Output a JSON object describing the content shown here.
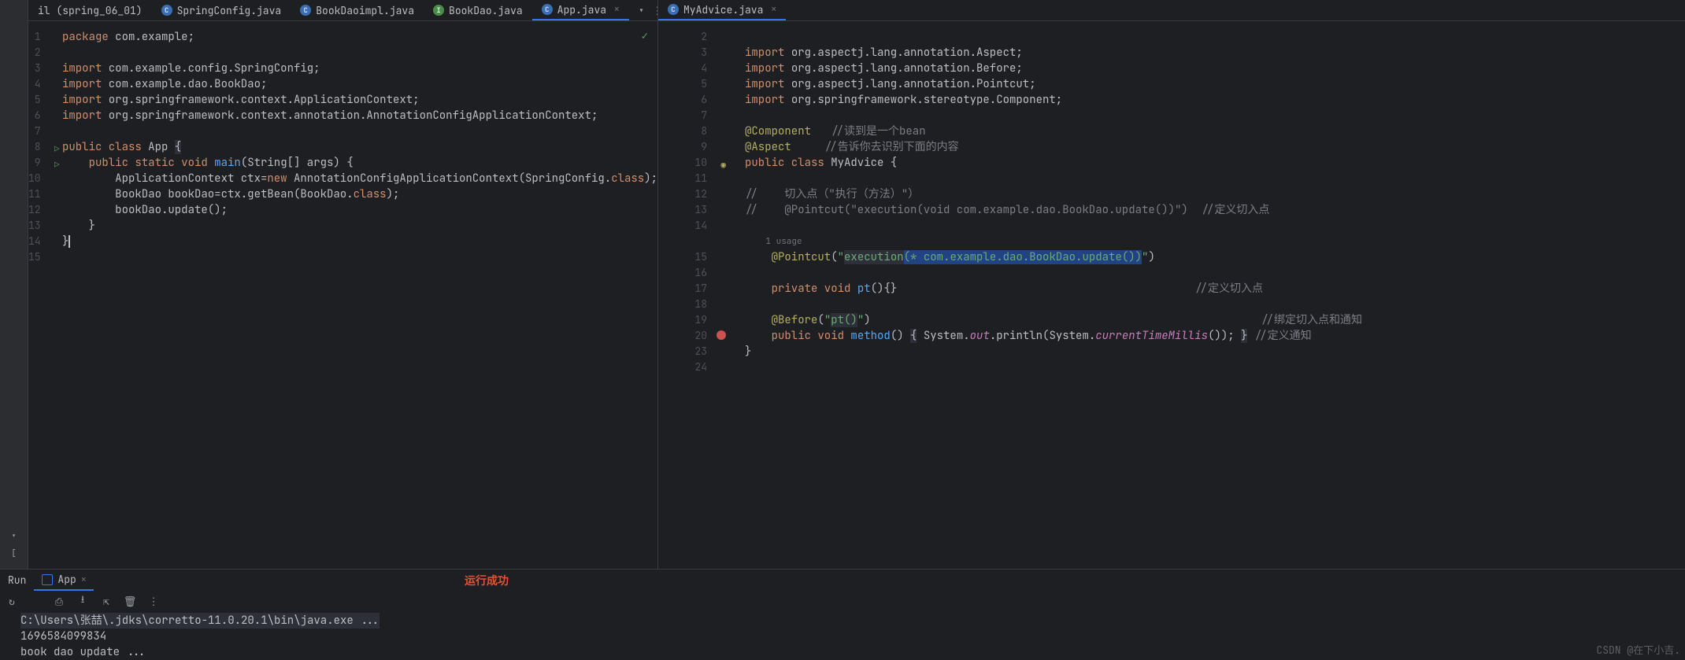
{
  "left": {
    "tabs": [
      {
        "label": "il (spring_06_01)",
        "icon": "",
        "active": false
      },
      {
        "label": "SpringConfig.java",
        "icon": "C",
        "active": false
      },
      {
        "label": "BookDaoimpl.java",
        "icon": "C",
        "active": false
      },
      {
        "label": "BookDao.java",
        "icon": "I",
        "active": false
      },
      {
        "label": "App.java",
        "icon": "C",
        "active": true
      }
    ],
    "status_ok": "✓",
    "code": [
      {
        "n": 1,
        "tokens": [
          {
            "t": "package ",
            "c": "kw"
          },
          {
            "t": "com.example;",
            "c": "cls"
          }
        ]
      },
      {
        "n": 2,
        "tokens": []
      },
      {
        "n": 3,
        "tokens": [
          {
            "t": "import ",
            "c": "kw"
          },
          {
            "t": "com.example.config.SpringConfig;",
            "c": "cls"
          }
        ]
      },
      {
        "n": 4,
        "tokens": [
          {
            "t": "import ",
            "c": "kw"
          },
          {
            "t": "com.example.dao.BookDao;",
            "c": "cls"
          }
        ]
      },
      {
        "n": 5,
        "tokens": [
          {
            "t": "import ",
            "c": "kw"
          },
          {
            "t": "org.springframework.context.ApplicationContext;",
            "c": "cls"
          }
        ]
      },
      {
        "n": 6,
        "tokens": [
          {
            "t": "import ",
            "c": "kw"
          },
          {
            "t": "org.springframework.context.annotation.AnnotationConfigApplicationContext;",
            "c": "cls"
          }
        ]
      },
      {
        "n": 7,
        "tokens": []
      },
      {
        "n": 8,
        "run": true,
        "tokens": [
          {
            "t": "public class ",
            "c": "kw"
          },
          {
            "t": "App ",
            "c": "cls"
          },
          {
            "t": "{",
            "c": "cls",
            "hl": true
          }
        ]
      },
      {
        "n": 9,
        "run": true,
        "tokens": [
          {
            "t": "    ",
            "c": ""
          },
          {
            "t": "public static void ",
            "c": "kw"
          },
          {
            "t": "main",
            "c": "fn"
          },
          {
            "t": "(String[] args) {",
            "c": "cls"
          }
        ]
      },
      {
        "n": 10,
        "tokens": [
          {
            "t": "        ApplicationContext ctx=",
            "c": "cls"
          },
          {
            "t": "new ",
            "c": "kw"
          },
          {
            "t": "AnnotationConfigApplicationContext(SpringConfig.",
            "c": "cls"
          },
          {
            "t": "class",
            "c": "kw"
          },
          {
            "t": ");",
            "c": "cls"
          }
        ]
      },
      {
        "n": 11,
        "tokens": [
          {
            "t": "        BookDao bookDao=ctx.getBean(BookDao.",
            "c": "cls"
          },
          {
            "t": "class",
            "c": "kw"
          },
          {
            "t": ");",
            "c": "cls"
          }
        ]
      },
      {
        "n": 12,
        "tokens": [
          {
            "t": "        bookDao.update();",
            "c": "cls"
          }
        ]
      },
      {
        "n": 13,
        "tokens": [
          {
            "t": "    }",
            "c": "cls"
          }
        ]
      },
      {
        "n": 14,
        "tokens": [
          {
            "t": "}",
            "c": "cls"
          }
        ],
        "caret": true
      },
      {
        "n": 15,
        "tokens": []
      }
    ]
  },
  "right": {
    "tabs": [
      {
        "label": "MyAdvice.java",
        "icon": "C",
        "active": true
      }
    ],
    "code": [
      {
        "n": 2,
        "tokens": []
      },
      {
        "n": 3,
        "tokens": [
          {
            "t": "import ",
            "c": "kw"
          },
          {
            "t": "org.aspectj.lang.annotation.Aspect;",
            "c": "cls"
          }
        ]
      },
      {
        "n": 4,
        "tokens": [
          {
            "t": "import ",
            "c": "kw"
          },
          {
            "t": "org.aspectj.lang.annotation.Before;",
            "c": "cls"
          }
        ]
      },
      {
        "n": 5,
        "tokens": [
          {
            "t": "import ",
            "c": "kw"
          },
          {
            "t": "org.aspectj.lang.annotation.Pointcut;",
            "c": "cls"
          }
        ]
      },
      {
        "n": 6,
        "tokens": [
          {
            "t": "import ",
            "c": "kw"
          },
          {
            "t": "org.springframework.stereotype.Component;",
            "c": "cls"
          }
        ]
      },
      {
        "n": 7,
        "tokens": []
      },
      {
        "n": 8,
        "tokens": [
          {
            "t": "@Component",
            "c": "ann"
          },
          {
            "t": "   //读到是一个bean",
            "c": "cmt"
          }
        ]
      },
      {
        "n": 9,
        "tokens": [
          {
            "t": "@Aspect",
            "c": "ann"
          },
          {
            "t": "     //告诉你去识别下面的内容",
            "c": "cmt"
          }
        ]
      },
      {
        "n": 10,
        "mark": "aop",
        "tokens": [
          {
            "t": "public class ",
            "c": "kw"
          },
          {
            "t": "MyAdvice {",
            "c": "cls"
          }
        ]
      },
      {
        "n": 11,
        "tokens": []
      },
      {
        "n": 12,
        "tokens": [
          {
            "t": "//    切入点（\"执行（方法）\"）",
            "c": "cmt"
          }
        ]
      },
      {
        "n": 13,
        "tokens": [
          {
            "t": "//    @Pointcut(\"execution(void com.example.dao.BookDao.update())\")  //定义切入点",
            "c": "cmt"
          }
        ]
      },
      {
        "n": 14,
        "tokens": []
      },
      {
        "hint": "1 usage"
      },
      {
        "n": 15,
        "tokens": [
          {
            "t": "    ",
            "c": ""
          },
          {
            "t": "@Pointcut",
            "c": "ann"
          },
          {
            "t": "(",
            "c": "cls"
          },
          {
            "t": "\"",
            "c": "str"
          },
          {
            "t": "execution",
            "c": "str",
            "hl": true
          },
          {
            "t": "(* com.example.dao.BookDao.update())",
            "c": "str",
            "hl2": true
          },
          {
            "t": "\"",
            "c": "str"
          },
          {
            "t": ")",
            "c": "cls"
          }
        ]
      },
      {
        "n": 16,
        "tokens": []
      },
      {
        "n": 17,
        "tokens": [
          {
            "t": "    ",
            "c": ""
          },
          {
            "t": "private void ",
            "c": "kw"
          },
          {
            "t": "pt",
            "c": "fn"
          },
          {
            "t": "(){}",
            "c": "cls"
          },
          {
            "t": "                                             //定义切入点",
            "c": "cmt"
          }
        ]
      },
      {
        "n": 18,
        "tokens": []
      },
      {
        "n": 19,
        "tokens": [
          {
            "t": "    ",
            "c": ""
          },
          {
            "t": "@Before",
            "c": "ann"
          },
          {
            "t": "(",
            "c": "cls"
          },
          {
            "t": "\"",
            "c": "str"
          },
          {
            "t": "pt()",
            "c": "str",
            "hl": true
          },
          {
            "t": "\"",
            "c": "str"
          },
          {
            "t": ")",
            "c": "cls"
          },
          {
            "t": "                                                           //绑定切入点和通知",
            "c": "cmt"
          }
        ]
      },
      {
        "n": 20,
        "mark": "bug",
        "chevron": true,
        "tokens": [
          {
            "t": "    ",
            "c": ""
          },
          {
            "t": "public void ",
            "c": "kw"
          },
          {
            "t": "method",
            "c": "fn"
          },
          {
            "t": "() ",
            "c": "cls"
          },
          {
            "t": "{",
            "c": "cls",
            "hl": true
          },
          {
            "t": " System.",
            "c": "cls"
          },
          {
            "t": "out",
            "c": "field"
          },
          {
            "t": ".println(System.",
            "c": "cls"
          },
          {
            "t": "currentTimeMillis",
            "c": "field"
          },
          {
            "t": "()); ",
            "c": "cls"
          },
          {
            "t": "}",
            "c": "cls",
            "hl": true
          },
          {
            "t": " //定义通知",
            "c": "cmt"
          }
        ]
      },
      {
        "n": 23,
        "tokens": [
          {
            "t": "}",
            "c": "cls"
          }
        ]
      },
      {
        "n": 24,
        "tokens": []
      }
    ]
  },
  "run": {
    "panel_label": "Run",
    "tab_label": "App",
    "annotation": "运行成功",
    "annotation_color": "#e55336",
    "console": [
      {
        "t": "C:\\Users\\张喆\\.jdks\\corretto-11.0.20.1\\bin\\java.exe ...",
        "cmd": true
      },
      {
        "t": "1696584099834"
      },
      {
        "t": "book dao update ..."
      }
    ]
  },
  "watermark": "CSDN @在下小吉."
}
